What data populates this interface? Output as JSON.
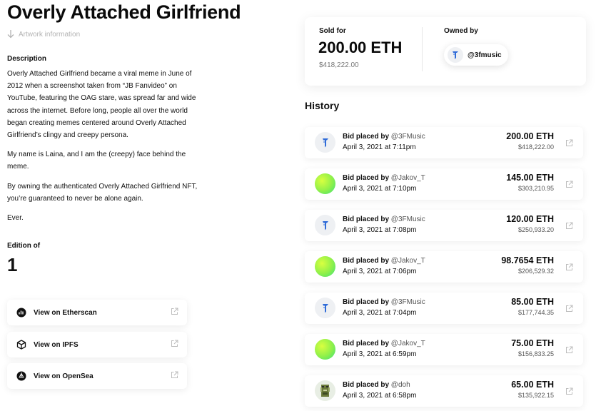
{
  "artwork": {
    "title": "Overly Attached Girlfriend",
    "info_label": "Artwork information",
    "description_heading": "Description",
    "description": [
      "Overly Attached Girlfriend became a viral meme in June of 2012 when a screenshot taken from “JB Fanvideo” on YouTube, featuring the OAG stare, was spread far and wide across the internet. Before long, people all over the world began creating memes centered around Overly Attached Girlfriend’s clingy and creepy persona.",
      "My name is Laina, and I am the (creepy) face behind the meme.",
      "By owning the authenticated Overly Attached Girlfriend NFT, you’re guaranteed to never be alone again.",
      "Ever."
    ],
    "edition_label": "Edition of",
    "edition_value": "1"
  },
  "links": [
    {
      "label": "View on Etherscan",
      "icon": "etherscan-icon"
    },
    {
      "label": "View on IPFS",
      "icon": "cube-icon"
    },
    {
      "label": "View on OpenSea",
      "icon": "opensea-icon"
    }
  ],
  "sale": {
    "sold_label": "Sold for",
    "price_eth": "200.00 ETH",
    "price_usd": "$418,222.00",
    "owned_label": "Owned by",
    "owner_handle": "@3fmusic"
  },
  "history": {
    "title": "History",
    "items": [
      {
        "prefix": "Bid placed by",
        "user": "@3FMusic",
        "date": "April 3, 2021 at 7:11pm",
        "eth": "200.00 ETH",
        "usd": "$418,222.00",
        "avatar": "blue-figure"
      },
      {
        "prefix": "Bid placed by",
        "user": "@Jakov_T",
        "date": "April 3, 2021 at 7:10pm",
        "eth": "145.00 ETH",
        "usd": "$303,210.95",
        "avatar": "green-gradient"
      },
      {
        "prefix": "Bid placed by",
        "user": "@3FMusic",
        "date": "April 3, 2021 at 7:08pm",
        "eth": "120.00 ETH",
        "usd": "$250,933.20",
        "avatar": "blue-figure"
      },
      {
        "prefix": "Bid placed by",
        "user": "@Jakov_T",
        "date": "April 3, 2021 at 7:06pm",
        "eth": "98.7654 ETH",
        "usd": "$206,529.32",
        "avatar": "green-gradient"
      },
      {
        "prefix": "Bid placed by",
        "user": "@3FMusic",
        "date": "April 3, 2021 at 7:04pm",
        "eth": "85.00 ETH",
        "usd": "$177,744.35",
        "avatar": "blue-figure"
      },
      {
        "prefix": "Bid placed by",
        "user": "@Jakov_T",
        "date": "April 3, 2021 at 6:59pm",
        "eth": "75.00 ETH",
        "usd": "$156,833.25",
        "avatar": "green-gradient"
      },
      {
        "prefix": "Bid placed by",
        "user": "@doh",
        "date": "April 3, 2021 at 6:58pm",
        "eth": "65.00 ETH",
        "usd": "$135,922.15",
        "avatar": "pixel-face"
      }
    ]
  }
}
